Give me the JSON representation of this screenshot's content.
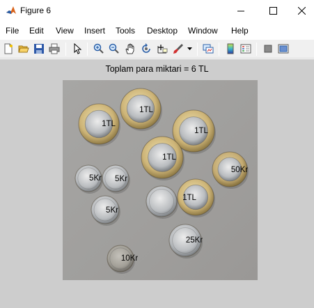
{
  "window": {
    "title": "Figure 6",
    "icon": "matlab-icon",
    "controls": [
      "minimize-icon",
      "maximize-icon",
      "close-icon"
    ]
  },
  "menu": {
    "items": [
      "File",
      "Edit",
      "View",
      "Insert",
      "Tools",
      "Desktop",
      "Window",
      "Help"
    ]
  },
  "toolbar": {
    "tools": [
      "new-figure-icon",
      "open-file-icon",
      "save-icon",
      "print-icon",
      "pointer-icon",
      "zoom-in-icon",
      "zoom-out-icon",
      "pan-hand-icon",
      "rotate-3d-icon",
      "data-cursor-icon",
      "brush-icon",
      "link-plot-icon",
      "colorbar-icon",
      "legend-icon",
      "hide-plot-tools-icon",
      "show-plot-tools-icon"
    ]
  },
  "figure": {
    "title": "Toplam para miktari = 6 TL",
    "background_color": "#cdcdcd",
    "coins": [
      {
        "label": "1TL"
      },
      {
        "label": "1TL"
      },
      {
        "label": "1TL"
      },
      {
        "label": "1TL"
      },
      {
        "label": "50Kr"
      },
      {
        "label": "5Kr"
      },
      {
        "label": "5Kr"
      },
      {
        "label": "1TL"
      },
      {
        "label": "5Kr"
      },
      {
        "label": "25Kr"
      },
      {
        "label": "10Kr"
      }
    ]
  }
}
